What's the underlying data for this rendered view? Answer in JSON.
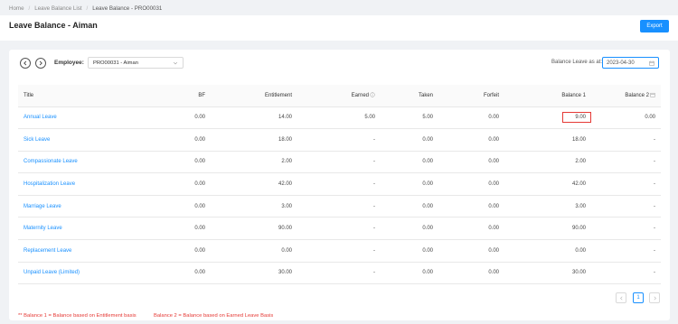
{
  "breadcrumb": {
    "home": "Home",
    "list": "Leave Balance List",
    "current": "Leave Balance - PRO00031",
    "sep": "/"
  },
  "page": {
    "title": "Leave Balance - Aiman",
    "export_label": "Export"
  },
  "filter": {
    "employee_label": "Employee:",
    "employee_value": "PRO00031 - Aiman",
    "balance_label": "Balance Leave as at:",
    "date_value": "2023-04-30"
  },
  "table": {
    "headers": [
      "Title",
      "BF",
      "Entitlement",
      "Earned",
      "Taken",
      "Forfeit",
      "Balance 1",
      "Balance 2"
    ],
    "rows": [
      [
        "Annual Leave",
        "0.00",
        "14.00",
        "5.00",
        "5.00",
        "0.00",
        "9.00",
        "0.00"
      ],
      [
        "Sick Leave",
        "0.00",
        "18.00",
        "-",
        "0.00",
        "0.00",
        "18.00",
        "-"
      ],
      [
        "Compassionate Leave",
        "0.00",
        "2.00",
        "-",
        "0.00",
        "0.00",
        "2.00",
        "-"
      ],
      [
        "Hospitalization Leave",
        "0.00",
        "42.00",
        "-",
        "0.00",
        "0.00",
        "42.00",
        "-"
      ],
      [
        "Marriage Leave",
        "0.00",
        "3.00",
        "-",
        "0.00",
        "0.00",
        "3.00",
        "-"
      ],
      [
        "Maternity Leave",
        "0.00",
        "90.00",
        "-",
        "0.00",
        "0.00",
        "90.00",
        "-"
      ],
      [
        "Replacement Leave",
        "0.00",
        "0.00",
        "-",
        "0.00",
        "0.00",
        "0.00",
        "-"
      ],
      [
        "Unpaid Leave (Limited)",
        "0.00",
        "30.00",
        "-",
        "0.00",
        "0.00",
        "30.00",
        "-"
      ]
    ]
  },
  "pagination": {
    "current_page": "1"
  },
  "notes": {
    "note1": "** Balance 1 = Balance based on Entitlement basis",
    "note2": "Balance 2 = Balance based on Earned Leave Basis"
  },
  "colors": {
    "accent": "#1890ff",
    "highlight": "#e53935"
  }
}
